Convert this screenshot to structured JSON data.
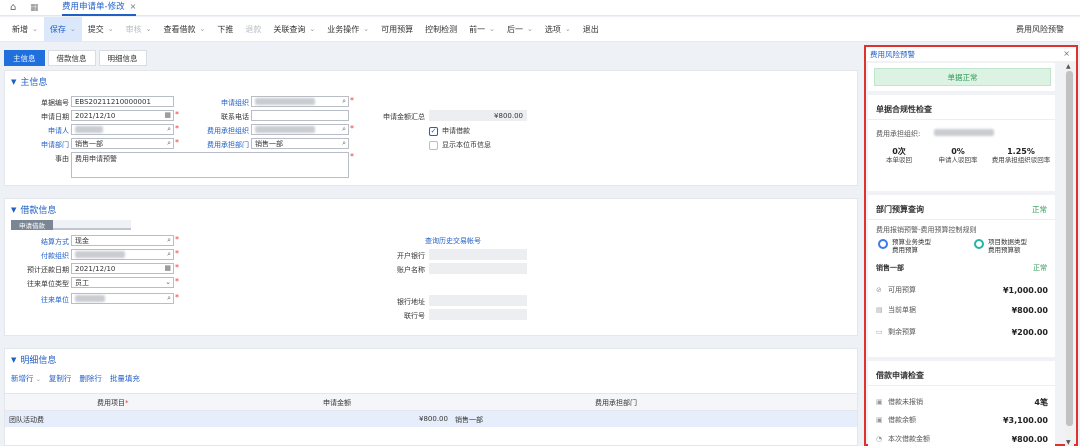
{
  "topbar": {
    "tab_title": "费用申请单-修改"
  },
  "toolbar": {
    "items": [
      {
        "label": "新增",
        "chev": true,
        "state": "normal"
      },
      {
        "label": "保存",
        "chev": true,
        "state": "active"
      },
      {
        "label": "提交",
        "chev": true,
        "state": "normal"
      },
      {
        "label": "审核",
        "chev": true,
        "state": "disabled"
      },
      {
        "label": "查看借款",
        "chev": true,
        "state": "normal"
      },
      {
        "label": "下推",
        "chev": false,
        "state": "normal"
      },
      {
        "label": "退款",
        "chev": false,
        "state": "disabled"
      },
      {
        "label": "关联查询",
        "chev": true,
        "state": "normal"
      },
      {
        "label": "业务操作",
        "chev": true,
        "state": "normal"
      },
      {
        "label": "可用预算",
        "chev": false,
        "state": "normal"
      },
      {
        "label": "控制检测",
        "chev": false,
        "state": "normal"
      },
      {
        "label": "前一",
        "chev": true,
        "state": "normal"
      },
      {
        "label": "后一",
        "chev": true,
        "state": "normal"
      },
      {
        "label": "选项",
        "chev": true,
        "state": "normal"
      },
      {
        "label": "退出",
        "chev": false,
        "state": "normal"
      }
    ],
    "right_label": "费用风险预警"
  },
  "subtabs": [
    "主信息",
    "借款信息",
    "明细信息"
  ],
  "main_info": {
    "title": "主信息",
    "doc_no_label": "单据编号",
    "doc_no": "EBS20211210000001",
    "apply_date_label": "申请日期",
    "apply_date": "2021/12/10",
    "applicant_label": "申请人",
    "apply_dept_label": "申请部门",
    "apply_dept": "销售一部",
    "reason_label": "事由",
    "reason": "费用申请预警",
    "apply_org_label": "申请组织",
    "phone_label": "联系电话",
    "cost_org_label": "费用承担组织",
    "cost_dept_label": "费用承担部门",
    "cost_dept": "销售一部",
    "total_label": "申请金额汇总",
    "total": "¥800.00",
    "borrow_check": "申请借款",
    "local_currency_check": "显示本位币信息"
  },
  "loan_info": {
    "title": "借款信息",
    "chip": "申请借款",
    "settle_label": "结算方式",
    "settle": "现金",
    "pay_org_label": "付款组织",
    "repay_date_label": "预计还款日期",
    "repay_date": "2021/12/10",
    "partner_type_label": "往来单位类型",
    "partner_type": "员工",
    "partner_label": "往来单位",
    "history_link": "查询历史交易帐号",
    "bank_label": "开户银行",
    "account_name_label": "账户名称",
    "bank_address_label": "银行地址",
    "bank_no_label": "联行号"
  },
  "detail_info": {
    "title": "明细信息",
    "actions": [
      "新增行",
      "复制行",
      "删除行",
      "批量填充"
    ],
    "columns": [
      "费用项目",
      "申请金额",
      "费用承担部门"
    ],
    "rows": [
      {
        "item": "团队活动费",
        "amount": "¥800.00",
        "dept": "销售一部"
      }
    ]
  },
  "risk_panel": {
    "title": "费用风险预警",
    "status_banner": "单据正常",
    "compliance": {
      "title": "单据合规性检查",
      "org_label": "费用承担组织:",
      "stats": [
        {
          "value": "0次",
          "label": "本单驳回"
        },
        {
          "value": "0%",
          "label": "申请人驳回率"
        },
        {
          "value": "1.25%",
          "label": "费用承担组织驳回率"
        }
      ]
    },
    "budget": {
      "title": "部门预算查询",
      "status": "正常",
      "rule": "费用报销预警-费用预算控制规则",
      "chips": [
        {
          "line1": "预算业务类型",
          "line2": "费用预算"
        },
        {
          "line1": "项目数据类型",
          "line2": "费用预算额"
        }
      ],
      "dept": "销售一部",
      "dept_status": "正常",
      "rows": [
        {
          "label": "可用预算",
          "value": "¥1,000.00"
        },
        {
          "label": "当前单据",
          "value": "¥800.00"
        },
        {
          "label": "剩余预算",
          "value": "¥200.00"
        }
      ]
    },
    "loan_check": {
      "title": "借款申请检查",
      "rows": [
        {
          "label": "借款未报销",
          "value": "4笔"
        },
        {
          "label": "借款余额",
          "value": "¥3,100.00"
        },
        {
          "label": "本次借款金额",
          "value": "¥800.00"
        }
      ]
    }
  }
}
